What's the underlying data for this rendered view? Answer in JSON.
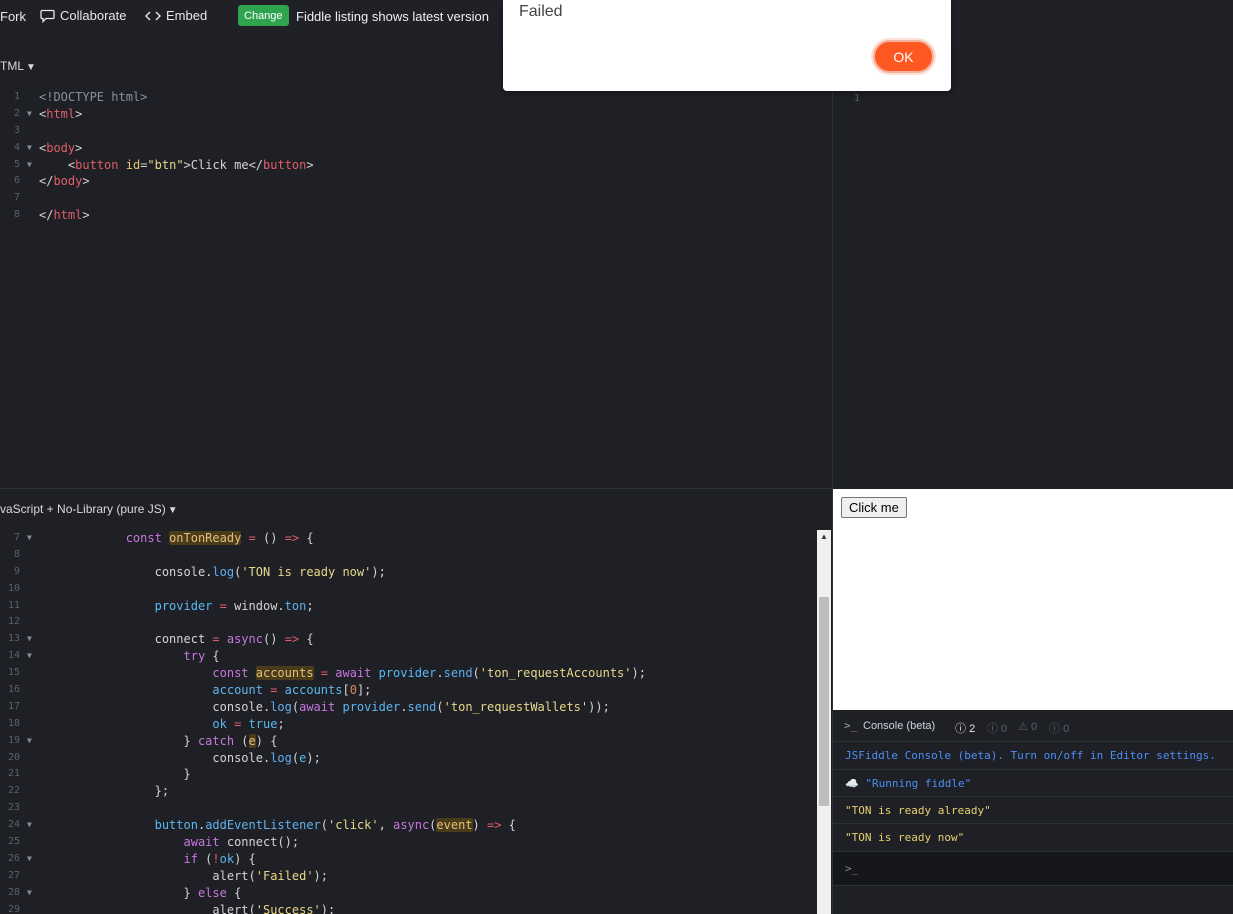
{
  "topbar": {
    "fork_label": "Fork",
    "collaborate_label": "Collaborate",
    "embed_label": "Embed",
    "change_badge": "Change",
    "fiddle_listing": "Fiddle listing shows latest version"
  },
  "html_panel": {
    "label": "TML",
    "lines": [
      {
        "n": "1",
        "fold": false
      },
      {
        "n": "2",
        "fold": true
      },
      {
        "n": "3",
        "fold": false
      },
      {
        "n": "4",
        "fold": true
      },
      {
        "n": "5",
        "fold": true
      },
      {
        "n": "6",
        "fold": false
      },
      {
        "n": "7",
        "fold": false
      },
      {
        "n": "8",
        "fold": false
      }
    ]
  },
  "css_panel": {
    "line_number": "1"
  },
  "js_panel": {
    "label": "vaScript + No-Library (pure JS)",
    "line_numbers": [
      "7",
      "8",
      "9",
      "10",
      "11",
      "12",
      "13",
      "14",
      "15",
      "16",
      "17",
      "18",
      "19",
      "20",
      "21",
      "22",
      "23",
      "24",
      "25",
      "26",
      "27",
      "28",
      "29"
    ]
  },
  "result": {
    "button_label": "Click me"
  },
  "console": {
    "title": "Console (beta)",
    "info_count": "2",
    "log_count": "0",
    "warn_count": "0",
    "error_count": "0",
    "rows": [
      {
        "text": "JSFiddle Console (beta). Turn on/off in Editor settings.",
        "color": "#4d8ff5"
      },
      {
        "text": "\"Running fiddle\"",
        "color": "#4d8ff5",
        "icon": "☁️"
      },
      {
        "text": "\"TON is ready already\"",
        "color": "#e8d070"
      },
      {
        "text": "\"TON is ready now\"",
        "color": "#e8d070"
      }
    ],
    "prompt": ">_"
  },
  "alert": {
    "message": "Failed",
    "ok_label": "OK"
  },
  "colors": {
    "accent": "#ff5722",
    "change_green": "#2ea44f",
    "editor_bg": "#1e2025"
  }
}
